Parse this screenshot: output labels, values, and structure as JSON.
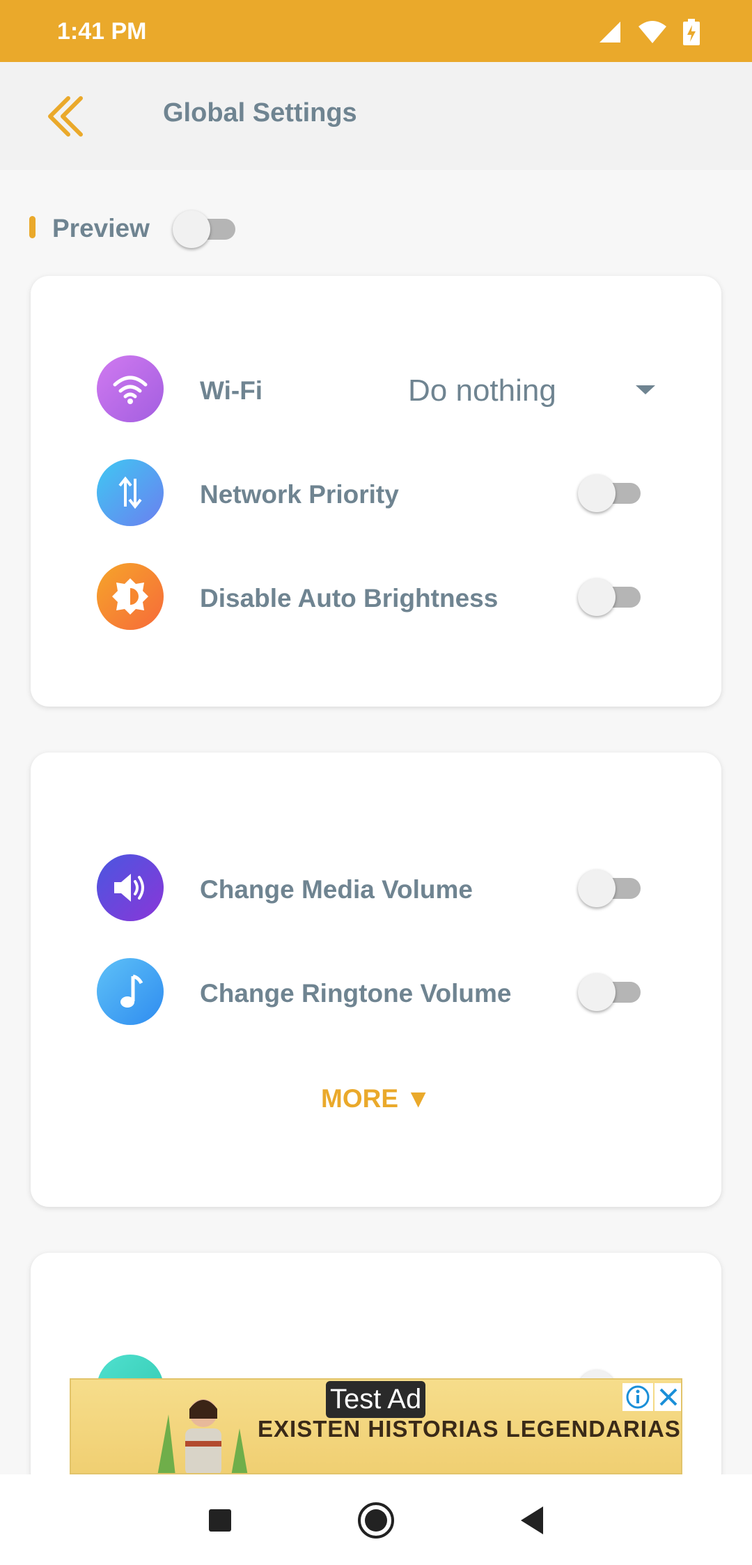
{
  "status_bar": {
    "time": "1:41 PM",
    "icons": [
      "signal-icon",
      "wifi-icon",
      "battery-charging-icon"
    ]
  },
  "header": {
    "title": "Global Settings",
    "back_icon": "double-chevron-left-icon"
  },
  "preview": {
    "label": "Preview",
    "enabled": false
  },
  "card1": {
    "rows": [
      {
        "label": "Wi-Fi",
        "icon": "wifi-icon",
        "control": "dropdown",
        "value": "Do nothing"
      },
      {
        "label": "Network Priority",
        "icon": "swap-vertical-icon",
        "control": "switch",
        "enabled": false
      },
      {
        "label": "Disable Auto Brightness",
        "icon": "brightness-icon",
        "control": "switch",
        "enabled": false
      }
    ]
  },
  "card2": {
    "rows": [
      {
        "label": "Change Media Volume",
        "icon": "speaker-icon",
        "control": "switch",
        "enabled": false
      },
      {
        "label": "Change Ringtone Volume",
        "icon": "music-note-icon",
        "control": "switch",
        "enabled": false
      }
    ],
    "more_label": "MORE ▼"
  },
  "ad": {
    "tag": "Test Ad",
    "headline": "EXISTEN HISTORIAS LEGENDARIAS"
  },
  "nav_bar": {
    "buttons": [
      "recents-square-icon",
      "home-circle-icon",
      "back-triangle-icon"
    ]
  },
  "colors": {
    "accent": "#eaa92b",
    "text": "#6f8491",
    "wifi": "#b868e8",
    "network": "#4a9bf0",
    "brightness": "#f7872f",
    "media": "#6a3fd8",
    "ringtone": "#3aa3f5"
  }
}
